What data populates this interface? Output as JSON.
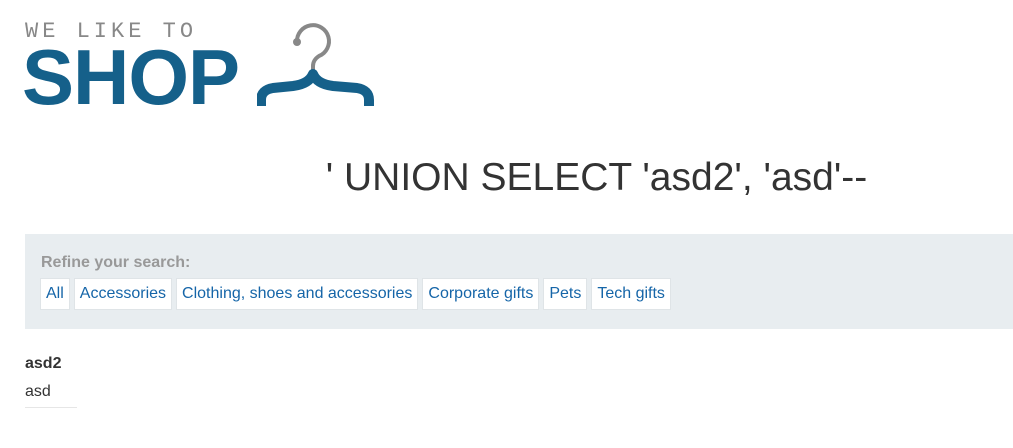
{
  "logo": {
    "tagline": "WE LIKE TO",
    "word": "SHOP",
    "brand_color": "#15608a",
    "icon": "hanger-icon"
  },
  "search": {
    "heading": "' UNION SELECT 'asd2', 'asd'--"
  },
  "filters": {
    "label": "Refine your search:",
    "items": [
      {
        "label": "All"
      },
      {
        "label": "Accessories"
      },
      {
        "label": "Clothing, shoes and accessories"
      },
      {
        "label": "Corporate gifts"
      },
      {
        "label": "Pets"
      },
      {
        "label": "Tech gifts"
      }
    ],
    "link_color": "#1565a8",
    "panel_color": "#e8edf0"
  },
  "results": [
    {
      "title": "asd2",
      "body": "asd"
    }
  ]
}
